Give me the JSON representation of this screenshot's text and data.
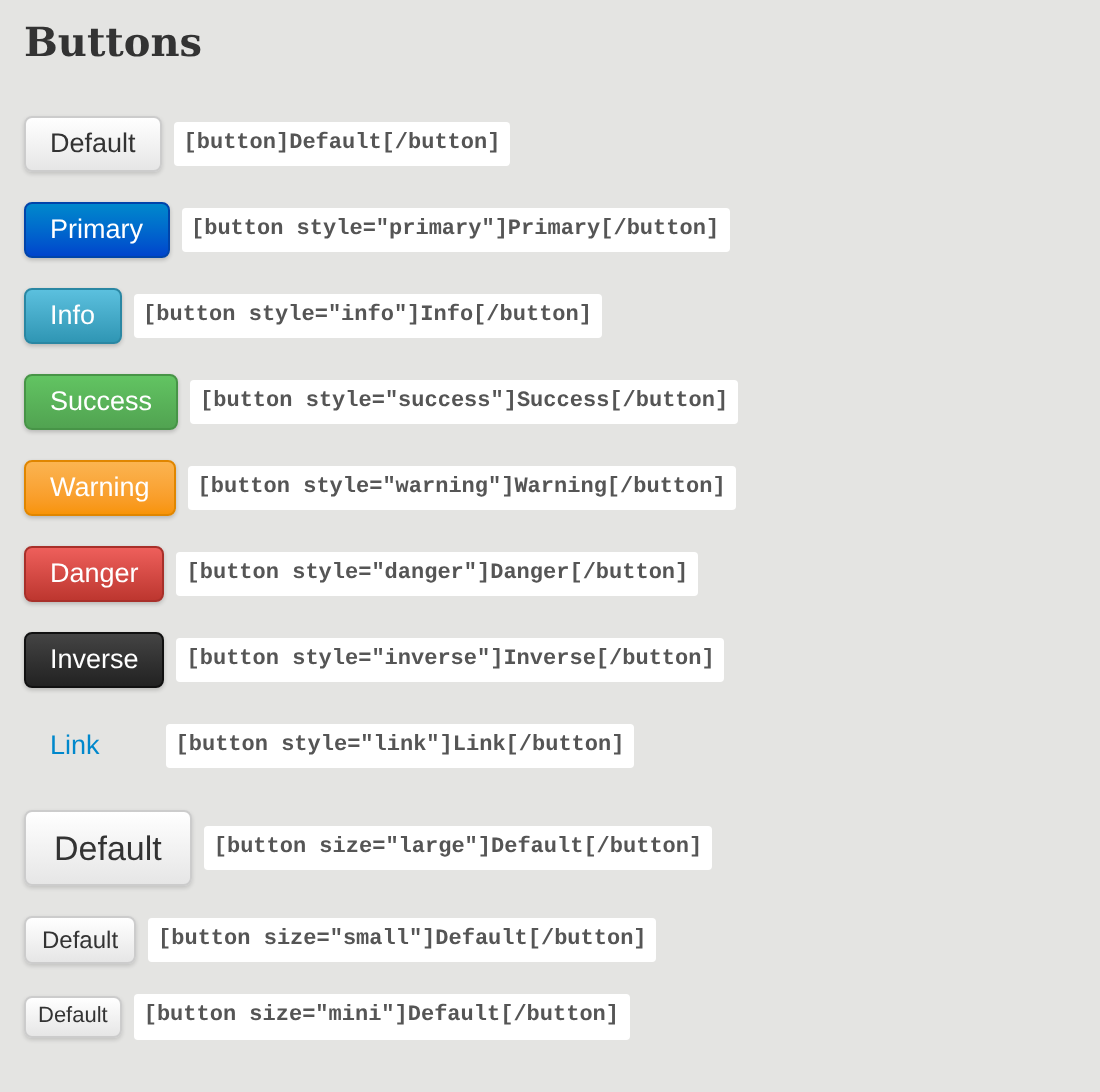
{
  "title": "Buttons",
  "examples": [
    {
      "label": "Default",
      "kind": "default",
      "code": "[button]Default[/button]"
    },
    {
      "label": "Primary",
      "kind": "primary",
      "code": "[button style=\"primary\"]Primary[/button]"
    },
    {
      "label": "Info",
      "kind": "info",
      "code": "[button style=\"info\"]Info[/button]"
    },
    {
      "label": "Success",
      "kind": "success",
      "code": "[button style=\"success\"]Success[/button]"
    },
    {
      "label": "Warning",
      "kind": "warning",
      "code": "[button style=\"warning\"]Warning[/button]"
    },
    {
      "label": "Danger",
      "kind": "danger",
      "code": "[button style=\"danger\"]Danger[/button]"
    },
    {
      "label": "Inverse",
      "kind": "inverse",
      "code": "[button style=\"inverse\"]Inverse[/button]"
    },
    {
      "label": "Link",
      "kind": "link",
      "code": "[button style=\"link\"]Link[/button]"
    },
    {
      "label": "Default",
      "kind": "large",
      "code": "[button size=\"large\"]Default[/button]"
    },
    {
      "label": "Default",
      "kind": "small",
      "code": "[button size=\"small\"]Default[/button]"
    },
    {
      "label": "Default",
      "kind": "mini",
      "code": "[button size=\"mini\"]Default[/button]"
    }
  ]
}
